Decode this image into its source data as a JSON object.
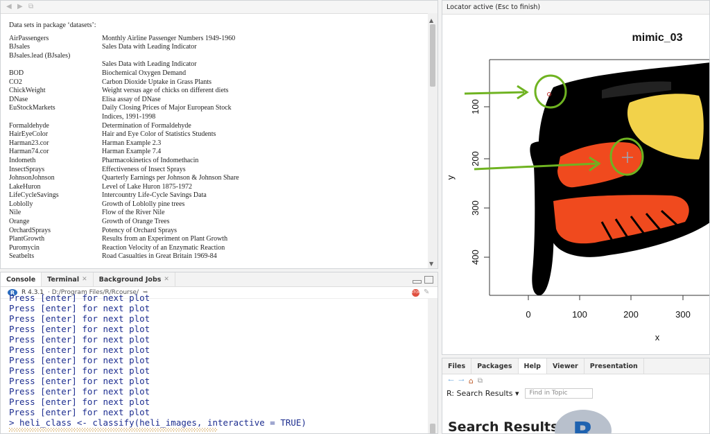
{
  "datasets": {
    "header": "Data sets in package ‘datasets’:",
    "rows": [
      {
        "name": "AirPassengers",
        "desc": "Monthly Airline Passenger Numbers 1949-1960"
      },
      {
        "name": "BJsales",
        "desc": "Sales Data with Leading Indicator"
      },
      {
        "name": "BJsales.lead (BJsales)",
        "desc": ""
      },
      {
        "name": "",
        "desc": "Sales Data with Leading Indicator"
      },
      {
        "name": "BOD",
        "desc": "Biochemical Oxygen Demand"
      },
      {
        "name": "CO2",
        "desc": "Carbon Dioxide Uptake in Grass Plants"
      },
      {
        "name": "ChickWeight",
        "desc": "Weight versus age of chicks on different diets"
      },
      {
        "name": "DNase",
        "desc": "Elisa assay of DNase"
      },
      {
        "name": "EuStockMarkets",
        "desc": "Daily Closing Prices of Major European Stock"
      },
      {
        "name": "",
        "desc": "Indices, 1991-1998"
      },
      {
        "name": "Formaldehyde",
        "desc": "Determination of Formaldehyde"
      },
      {
        "name": "HairEyeColor",
        "desc": "Hair and Eye Color of Statistics Students"
      },
      {
        "name": "Harman23.cor",
        "desc": "Harman Example 2.3"
      },
      {
        "name": "Harman74.cor",
        "desc": "Harman Example 7.4"
      },
      {
        "name": "Indometh",
        "desc": "Pharmacokinetics of Indomethacin"
      },
      {
        "name": "InsectSprays",
        "desc": "Effectiveness of Insect Sprays"
      },
      {
        "name": "JohnsonJohnson",
        "desc": "Quarterly Earnings per Johnson & Johnson Share"
      },
      {
        "name": "LakeHuron",
        "desc": "Level of Lake Huron 1875-1972"
      },
      {
        "name": "LifeCycleSavings",
        "desc": "Intercountry Life-Cycle Savings Data"
      },
      {
        "name": "Loblolly",
        "desc": "Growth of Loblolly pine trees"
      },
      {
        "name": "Nile",
        "desc": "Flow of the River Nile"
      },
      {
        "name": "Orange",
        "desc": "Growth of Orange Trees"
      },
      {
        "name": "OrchardSprays",
        "desc": "Potency of Orchard Sprays"
      },
      {
        "name": "PlantGrowth",
        "desc": "Results from an Experiment on Plant Growth"
      },
      {
        "name": "Puromycin",
        "desc": "Reaction Velocity of an Enzymatic Reaction"
      },
      {
        "name": "Seatbelts",
        "desc": "Road Casualties in Great Britain 1969-84"
      }
    ]
  },
  "console": {
    "tabs": [
      {
        "label": "Console",
        "closable": false
      },
      {
        "label": "Terminal",
        "closable": true
      },
      {
        "label": "Background Jobs",
        "closable": true
      }
    ],
    "version": "R 4.3.1",
    "path": "· D:/Program Files/R/Rcourse/",
    "first_line": "Press [enter] for next plot",
    "repeat_line": "Press [enter] for next plot",
    "command": "> heli_class <- classify(heli_images, interactive = TRUE)"
  },
  "plot": {
    "status": "Locator active (Esc to finish)",
    "title": "mimic_03",
    "xlabel": "x",
    "ylabel": "y",
    "xticks": [
      "0",
      "100",
      "200",
      "300"
    ],
    "yticks": [
      "100",
      "200",
      "300",
      "400"
    ],
    "colors": {
      "black": "#000000",
      "orange": "#f04a1e",
      "yellow": "#f2d24a",
      "annot": "#6fb321"
    }
  },
  "help": {
    "tabs": [
      "Files",
      "Packages",
      "Help",
      "Viewer",
      "Presentation"
    ],
    "active_tab": "Help",
    "topic": "R: Search Results",
    "find_placeholder": "Find in Topic",
    "heading": "Search Results",
    "logo_letter": "R"
  }
}
